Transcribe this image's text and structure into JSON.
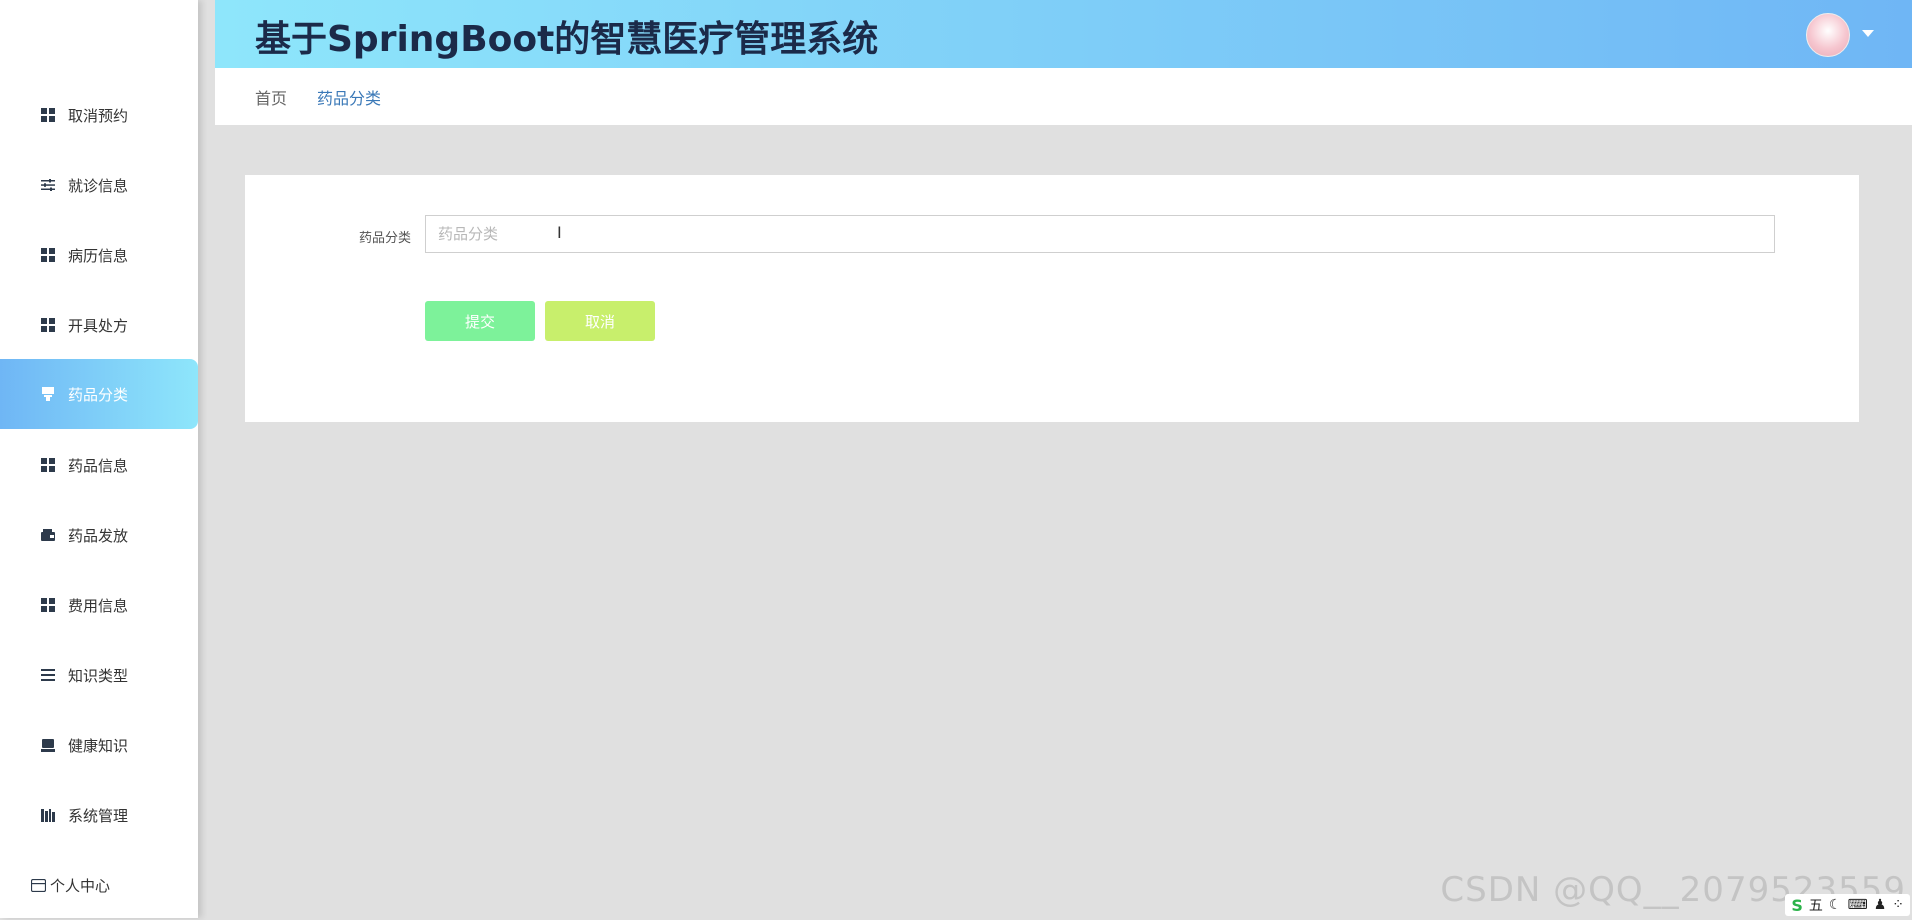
{
  "app": {
    "title": "基于SpringBoot的智慧医疗管理系统"
  },
  "sidebar": {
    "items": [
      {
        "label": "取消预约",
        "icon": "grid-icon"
      },
      {
        "label": "就诊信息",
        "icon": "sliders-icon"
      },
      {
        "label": "病历信息",
        "icon": "grid-icon"
      },
      {
        "label": "开具处方",
        "icon": "grid-icon"
      },
      {
        "label": "药品分类",
        "icon": "stamp-icon",
        "active": true
      },
      {
        "label": "药品信息",
        "icon": "grid-icon"
      },
      {
        "label": "药品发放",
        "icon": "wallet-icon"
      },
      {
        "label": "费用信息",
        "icon": "grid-icon"
      },
      {
        "label": "知识类型",
        "icon": "list-icon"
      },
      {
        "label": "健康知识",
        "icon": "monitor-icon"
      },
      {
        "label": "系统管理",
        "icon": "books-icon"
      },
      {
        "label": "个人中心",
        "icon": "card-icon"
      }
    ]
  },
  "breadcrumb": {
    "home": "首页",
    "current": "药品分类"
  },
  "form": {
    "label": "药品分类",
    "placeholder": "药品分类",
    "value": "",
    "submit_label": "提交",
    "cancel_label": "取消"
  },
  "watermark": "CSDN @QQ__2079523559",
  "tray": {
    "ime": "五",
    "logo": "S"
  },
  "colors": {
    "header_start": "#8ee6fb",
    "header_end": "#6fb6f5",
    "submit": "#7df29a",
    "cancel": "#c8ef6c",
    "breadcrumb_current": "#3a78b7"
  }
}
